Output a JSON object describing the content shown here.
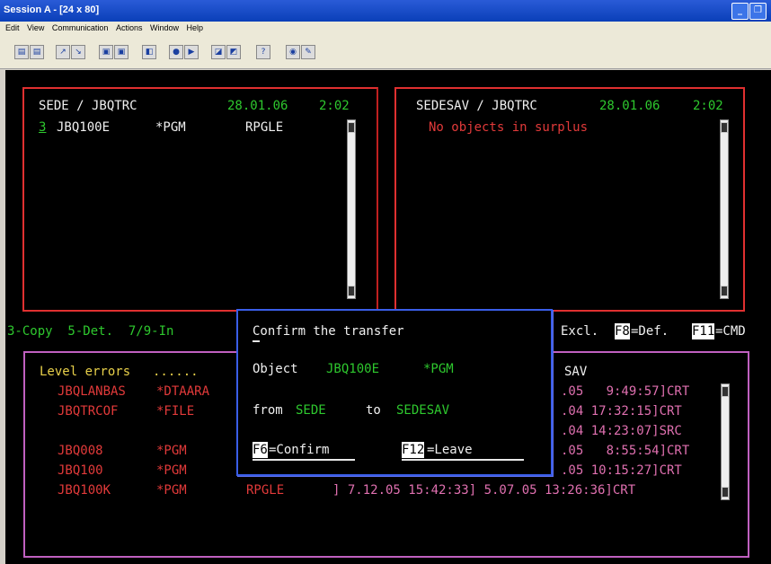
{
  "window": {
    "title": "Session A - [24 x 80]",
    "min_label": "_",
    "max_label": "❐"
  },
  "menu": [
    "Edit",
    "View",
    "Communication",
    "Actions",
    "Window",
    "Help"
  ],
  "toolbar_icons": [
    "copy-icon",
    "paste-icon",
    "send-icon",
    "receive-icon",
    "display-icon",
    "keyboard-icon",
    "macro-icon",
    "record-icon",
    "play-icon",
    "color-icon",
    "map-icon",
    "help-icon",
    "globe-icon",
    "settings-icon"
  ],
  "left_panel": {
    "header": "SEDE / JBQTRC",
    "date": "28.01.06",
    "time": "2:02",
    "row": {
      "option": "3",
      "name": "JBQ100E",
      "type": "*PGM",
      "attr": "RPGLE"
    }
  },
  "right_panel": {
    "header": "SEDESAV / JBQTRC",
    "date": "28.01.06",
    "time": "2:02",
    "message": "No objects in surplus"
  },
  "options_line": {
    "left": "3-Copy  5-Det.  7/9-In",
    "excl": "Excl.",
    "f8": "F8",
    "def": "=Def.",
    "f11": "F11",
    "cmd": "=CMD"
  },
  "bottom_panel": {
    "title": "Level errors",
    "dots": "......",
    "sav": "SAV",
    "rows": [
      {
        "name": "JBQLANBAS",
        "type": "*DTAARA",
        "attr": "",
        "mid": "",
        "right": ".05   9:49:57]CRT"
      },
      {
        "name": "JBQTRCOF",
        "type": "*FILE",
        "attr": "",
        "mid": "",
        "right": ".04 17:32:15]CRT"
      },
      {
        "name": "",
        "type": "",
        "attr": "",
        "mid": "",
        "right": ".04 14:23:07]SRC"
      },
      {
        "name": "JBQ008",
        "type": "*PGM",
        "attr": "",
        "mid": "",
        "right": ".05   8:55:54]CRT"
      },
      {
        "name": "JBQ100",
        "type": "*PGM",
        "attr": "",
        "mid": "",
        "right": ".05 10:15:27]CRT"
      },
      {
        "name": "JBQ100K",
        "type": "*PGM",
        "attr": "RPGLE",
        "mid": "] 7.12.05 15:42:33] 5.07.05 13:26:36]CRT",
        "right": ""
      }
    ]
  },
  "dialog": {
    "title": "Confirm the transfer",
    "object_label": "Object",
    "object_name": "JBQ100E",
    "object_type": "*PGM",
    "from_label": "from",
    "from_value": "SEDE",
    "to_label": "to",
    "to_value": "SEDESAV",
    "f6": "F6",
    "confirm": "=Confirm",
    "f12": "F12",
    "leave": "=Leave"
  },
  "colors": {
    "green": "#2ec82e",
    "red": "#e23a3a",
    "white": "#f0f0f0",
    "yellow": "#e8d04a",
    "blue_border": "#3a5ee8",
    "pink_border": "#c060c0"
  }
}
